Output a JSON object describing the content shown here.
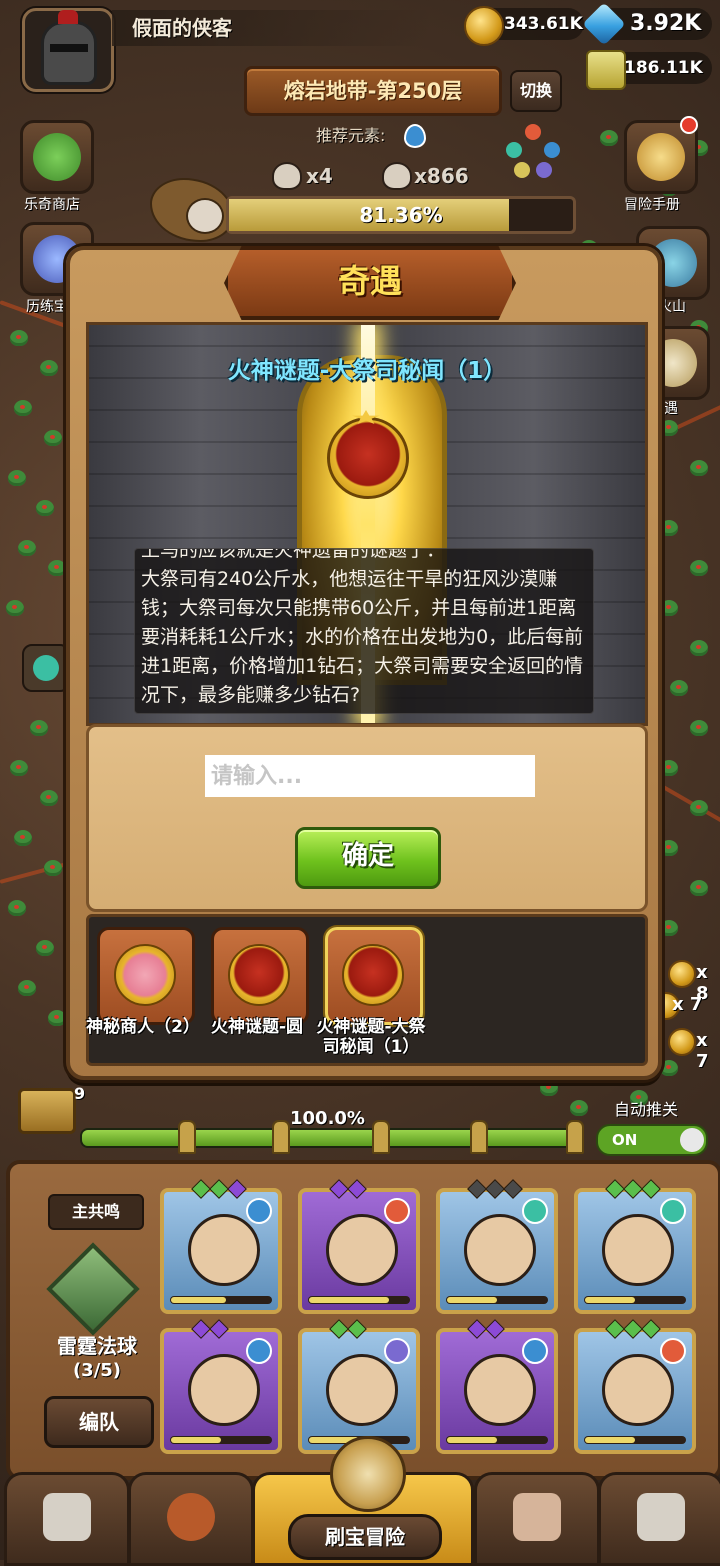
{
  "player": {
    "name": "假面的侠客"
  },
  "resources": {
    "coins": "343.61K",
    "gems": "3.92K",
    "potion": "186.11K"
  },
  "stage": {
    "title": "熔岩地带-第250层",
    "switch_label": "切换",
    "recommend_label": "推荐元素:",
    "skull_a": "x4",
    "skull_b": "x866",
    "progress_text": "81.36%",
    "progress_value": 0.8136
  },
  "side_left": [
    {
      "label": "乐奇商店"
    },
    {
      "label": "历练宝"
    }
  ],
  "side_right": [
    {
      "label": "冒险手册"
    },
    {
      "label": "火山"
    },
    {
      "label": "奇遇"
    }
  ],
  "event": {
    "title": "奇遇",
    "scene_title": "火神谜题-大祭司秘闻（1）",
    "story_cut": "上马的应该就是火神遗留的谜题了：",
    "story": "大祭司有240公斤水，他想运往干旱的狂风沙漠赚钱；大祭司每次只能携带60公斤，并且每前进1距离要消耗耗1公斤水；水的价格在出发地为0，此后每前进1距离，价格增加1钻石；大祭司需要安全返回的情况下，最多能赚多少钻石?",
    "input_placeholder": "请输入...",
    "confirm_label": "确定",
    "tabs": [
      {
        "label": "神秘商人（2）"
      },
      {
        "label": "火神谜题-圆"
      },
      {
        "label": "火神谜题-大祭司秘闻（1）"
      }
    ]
  },
  "bottom_progress": {
    "chest_count": "9",
    "text": "100.0%",
    "value": 1.0
  },
  "auto_push": {
    "label": "自动推关",
    "state": "ON"
  },
  "right_counts": [
    "x 8",
    "x 7",
    "x 7"
  ],
  "team": {
    "resonance_label": "主共鸣",
    "orb_name": "雷霆法球",
    "orb_count": "(3/5)",
    "formation_label": "编队",
    "heroes": [
      {
        "name": "hero-hood-blue",
        "element": "water",
        "hp": 0.55
      },
      {
        "name": "hero-demon",
        "element": "fire",
        "hp": 0.8
      },
      {
        "name": "hero-grey-hair",
        "element": "wind",
        "hp": 0.5
      },
      {
        "name": "hero-knight",
        "element": "wind",
        "hp": 0.5
      },
      {
        "name": "hero-girl-bun",
        "element": "water",
        "hp": 0.5
      },
      {
        "name": "hero-skull-hood",
        "element": "dark",
        "hp": 0.5
      },
      {
        "name": "hero-flower-girl",
        "element": "water",
        "hp": 0.5
      },
      {
        "name": "hero-pirate",
        "element": "fire",
        "hp": 0.5
      }
    ]
  },
  "nav": {
    "center_label": "刷宝冒险"
  },
  "colors": {
    "water": "#3b8ed1",
    "fire": "#e25b3a",
    "wind": "#3bbfa3",
    "dark": "#7a6ad0"
  }
}
